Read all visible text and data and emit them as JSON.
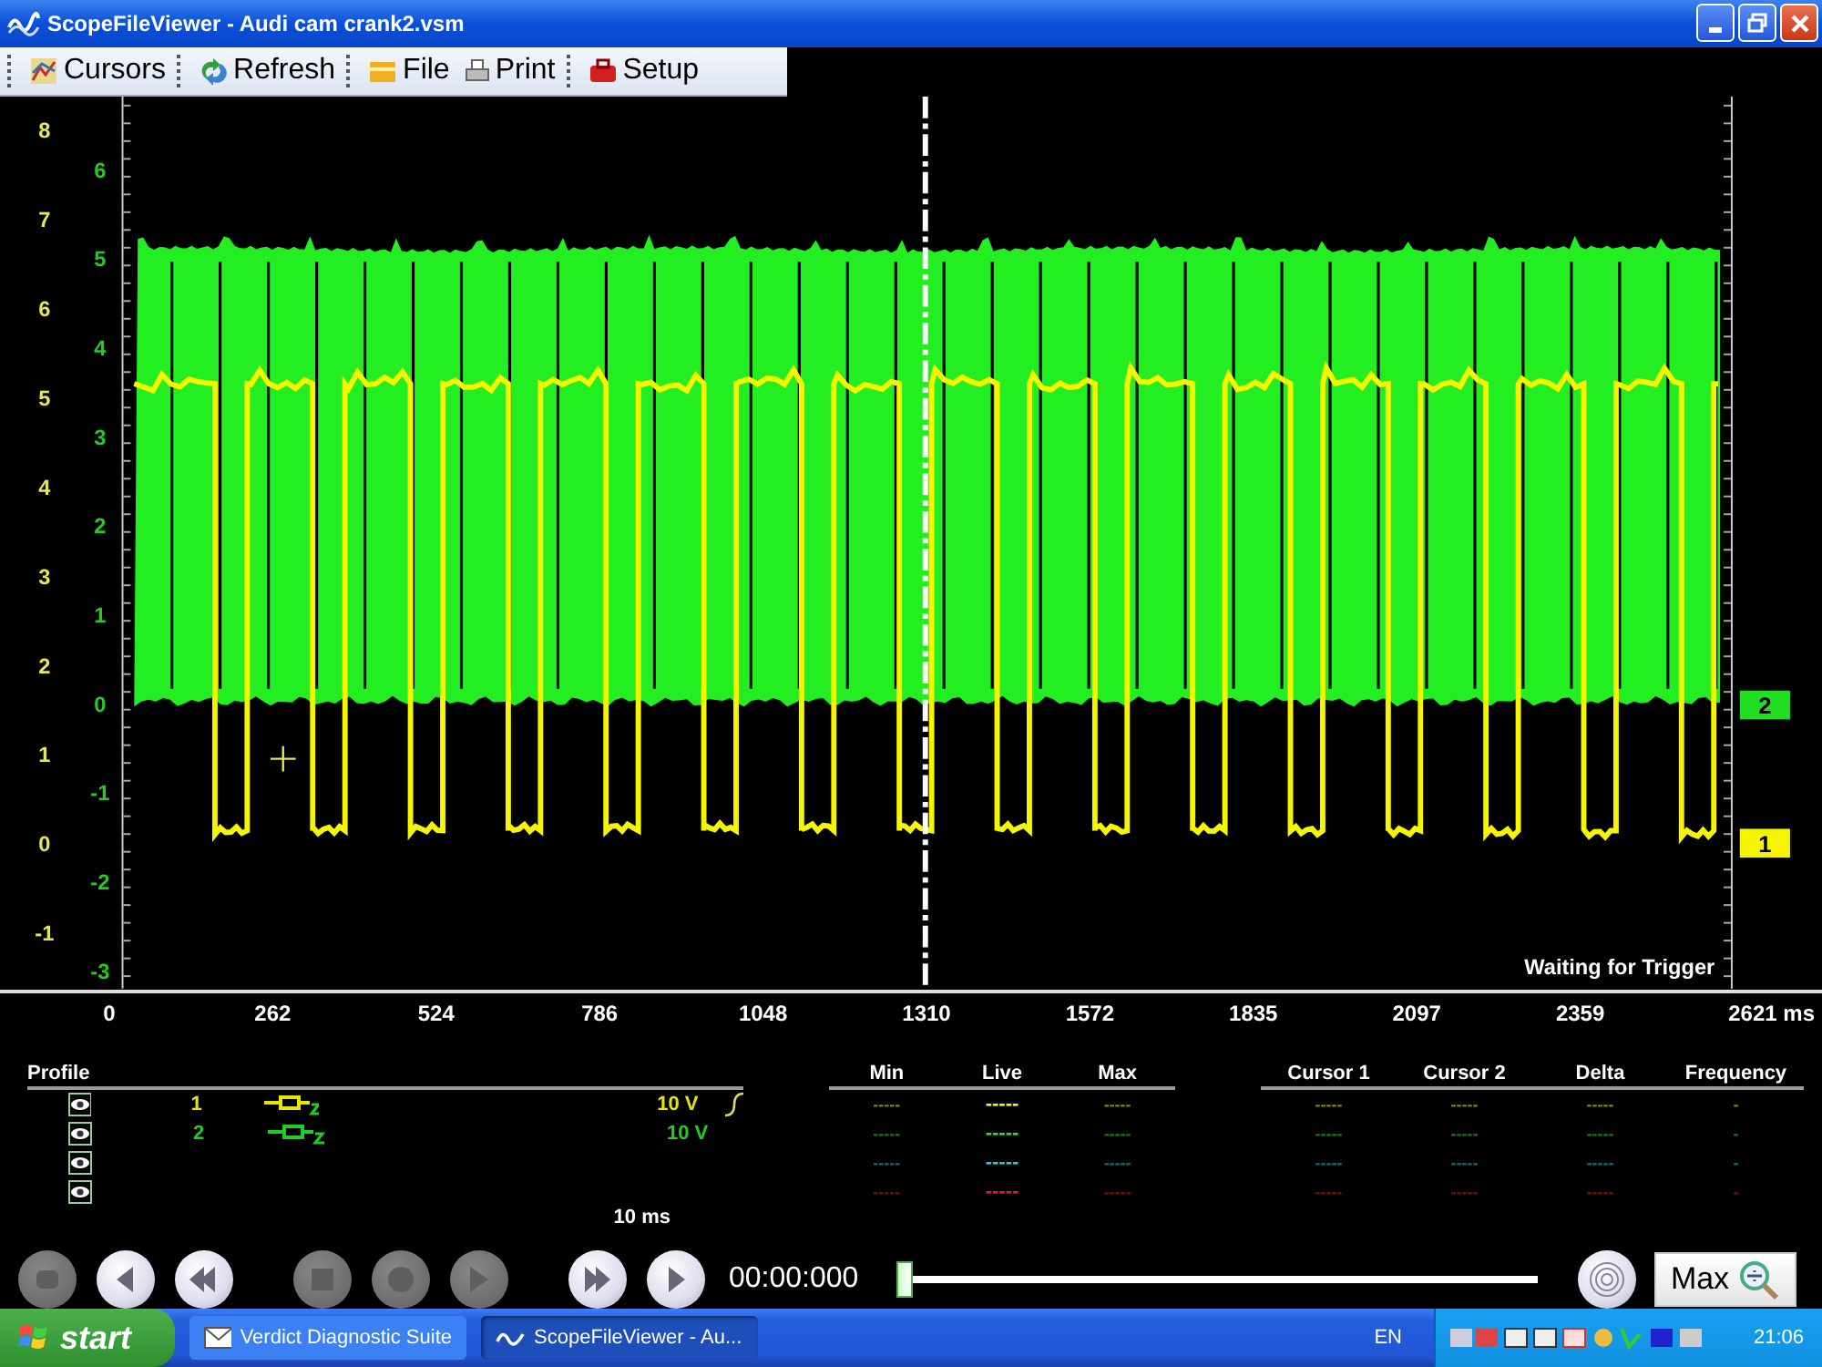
{
  "window": {
    "title": "ScopeFileViewer - Audi cam crank2.vsm"
  },
  "toolbar": [
    {
      "label": "Cursors",
      "kind": "cursors"
    },
    {
      "label": "Refresh",
      "kind": "refresh"
    },
    {
      "label": "File",
      "kind": "file"
    },
    {
      "label": "Print",
      "kind": "print"
    },
    {
      "label": "Setup",
      "kind": "setup"
    }
  ],
  "plot": {
    "y_axis_1": [
      "8",
      "7",
      "6",
      "5",
      "4",
      "3",
      "2",
      "1",
      "0",
      "-1"
    ],
    "y_axis_2": [
      "6",
      "5",
      "4",
      "3",
      "2",
      "1",
      "0",
      "-1",
      "-2",
      "-3"
    ],
    "x_axis": [
      "0",
      "262",
      "524",
      "786",
      "1048",
      "1310",
      "1572",
      "1835",
      "2097",
      "2359",
      "2621 ms"
    ],
    "status": "Waiting for Trigger",
    "markers": [
      {
        "label": "2",
        "color": "#22dd22"
      },
      {
        "label": "1",
        "color": "#f5f500"
      }
    ]
  },
  "profile": {
    "heading": "Profile",
    "channels": [
      {
        "number": "1",
        "range": "10 V",
        "color": "#e6e600",
        "trigger": true
      },
      {
        "number": "2",
        "range": "10 V",
        "color": "#22cc22",
        "trigger": false
      }
    ],
    "timebase": "10 ms"
  },
  "measurements": {
    "columns_1": [
      "Min",
      "Live",
      "Max"
    ],
    "columns_2": [
      "Cursor 1",
      "Cursor 2",
      "Delta",
      "Frequency"
    ],
    "rows": [
      {
        "color": "#f0f030",
        "min": "-----",
        "live": "-----",
        "max": "-----",
        "cursor_1": "-----",
        "cursor_2": "-----",
        "delta": "-----",
        "frequency": "-"
      },
      {
        "color": "#30e030",
        "min": "-----",
        "live": "-----",
        "max": "-----",
        "cursor_1": "-----",
        "cursor_2": "-----",
        "delta": "-----",
        "frequency": "-"
      },
      {
        "color": "#30c8d8",
        "min": "-----",
        "live": "-----",
        "max": "-----",
        "cursor_1": "-----",
        "cursor_2": "-----",
        "delta": "-----",
        "frequency": "-"
      },
      {
        "color": "#e02020",
        "min": "-----",
        "live": "-----",
        "max": "-----",
        "cursor_1": "-----",
        "cursor_2": "-----",
        "delta": "-----",
        "frequency": "-"
      }
    ]
  },
  "transport": {
    "buttons": [
      {
        "kind": "snapshot",
        "disabled": true
      },
      {
        "kind": "step-back",
        "disabled": false
      },
      {
        "kind": "rewind",
        "disabled": false
      },
      {
        "kind": "stop",
        "disabled": true
      },
      {
        "kind": "record",
        "disabled": true
      },
      {
        "kind": "play",
        "disabled": true
      },
      {
        "kind": "fast-forward",
        "disabled": false
      },
      {
        "kind": "step-forward",
        "disabled": false
      }
    ],
    "time": "00:00:000",
    "level": 0,
    "zoom_label": "Max"
  },
  "taskbar": {
    "start": "start",
    "tasks": [
      {
        "label": "Verdict Diagnostic Suite",
        "selected": false
      },
      {
        "label": "ScopeFileViewer - Au...",
        "selected": true
      }
    ],
    "language": "EN",
    "clock": "21:06"
  }
}
